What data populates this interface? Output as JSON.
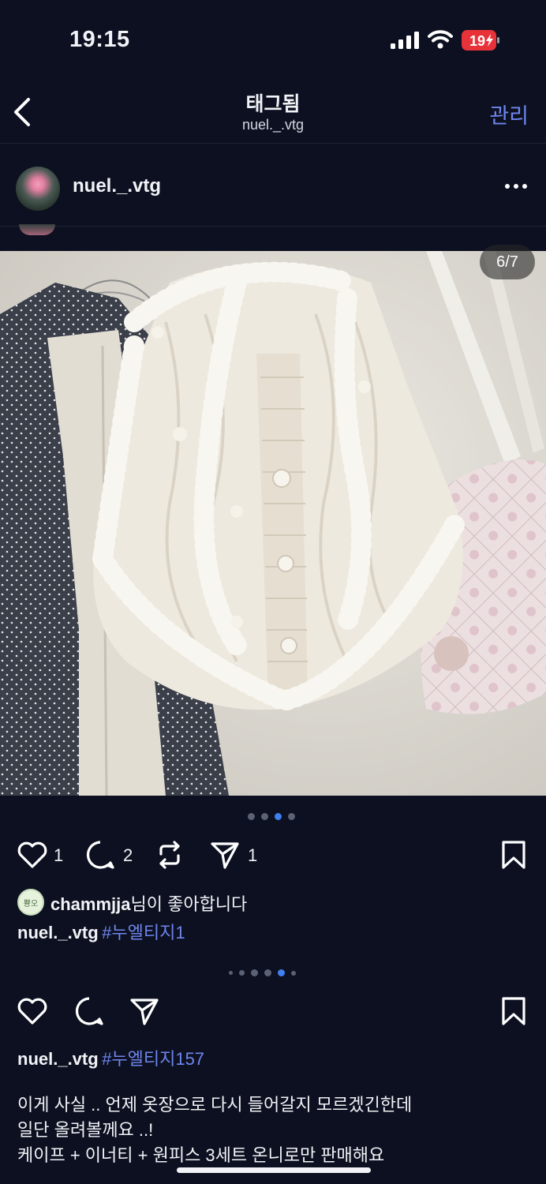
{
  "status_bar": {
    "time": "19:15",
    "battery": "19"
  },
  "header": {
    "title": "태그됨",
    "subtitle": "nuel._.vtg",
    "manage_label": "관리"
  },
  "post1": {
    "username": "nuel._.vtg",
    "image_counter": "6/7",
    "carousel": {
      "count": 4,
      "active": 3
    },
    "likes": "1",
    "comments": "2",
    "shares": "1",
    "liked_by_avatar": "뿅오",
    "liked_by_user": "chammjja",
    "liked_by_suffix": "님이 좋아합니다",
    "caption_user": "nuel._.vtg",
    "caption_tag": "#누엘티지1"
  },
  "post2": {
    "carousel": {
      "count": 6,
      "active": 5
    },
    "caption_user": "nuel._.vtg",
    "caption_tag": "#누엘티지157",
    "caption_lines": [
      "이게 사실 .. 언제 옷장으로 다시 들어갈지 모르겠긴한데",
      "일단 올려볼께요 ..!",
      "케이프 + 이너티 + 원피스 3세트 온니로만 판매해요"
    ]
  }
}
